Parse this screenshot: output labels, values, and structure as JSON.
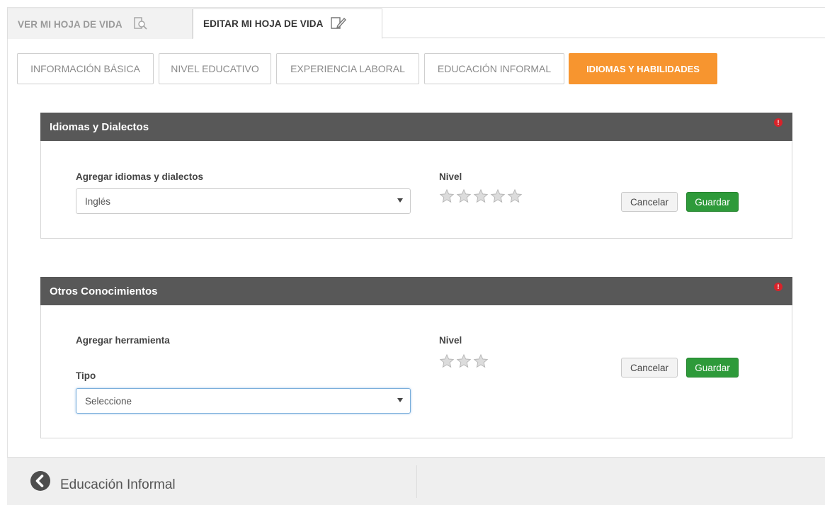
{
  "top_tabs": [
    {
      "label": "VER MI HOJA DE VIDA",
      "icon": "search-document-icon"
    },
    {
      "label": "EDITAR MI HOJA DE VIDA",
      "icon": "edit-document-icon"
    }
  ],
  "sub_tabs": [
    {
      "label": "INFORMACIÓN BÁSICA"
    },
    {
      "label": "NIVEL EDUCATIVO"
    },
    {
      "label": "EXPERIENCIA LABORAL"
    },
    {
      "label": "EDUCACIÓN INFORMAL"
    },
    {
      "label": "IDIOMAS Y HABILIDADES"
    }
  ],
  "colors": {
    "accent": "#f7952f",
    "panel_header": "#585858",
    "save_button": "#2e9a3a",
    "alert": "#d8232a"
  },
  "idiomas": {
    "title": "Idiomas y Dialectos",
    "alert_icon": "alert-icon",
    "add_label": "Agregar idiomas y dialectos",
    "selected": "Inglés",
    "level_label": "Nivel",
    "stars_total": 5,
    "stars_filled": 0,
    "cancel": "Cancelar",
    "save": "Guardar"
  },
  "otros": {
    "title": "Otros Conocimientos",
    "alert_icon": "alert-icon",
    "add_label": "Agregar herramienta",
    "tipo_label": "Tipo",
    "selected": "Seleccione",
    "level_label": "Nivel",
    "stars_total": 3,
    "stars_filled": 0,
    "cancel": "Cancelar",
    "save": "Guardar"
  },
  "footer": {
    "back_icon": "chevron-left-circle-icon",
    "back_label": "Educación Informal"
  }
}
